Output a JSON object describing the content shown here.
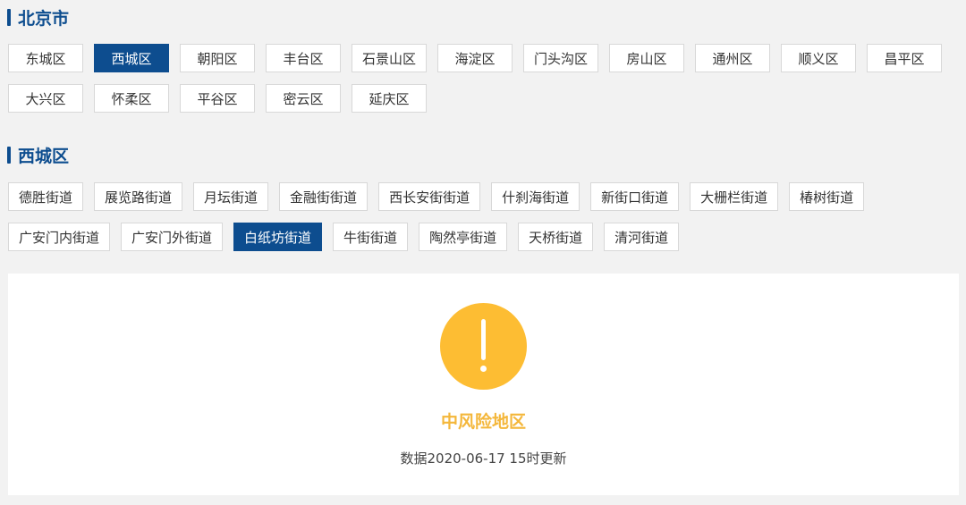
{
  "city": {
    "title": "北京市",
    "districts": [
      {
        "label": "东城区",
        "active": false
      },
      {
        "label": "西城区",
        "active": true
      },
      {
        "label": "朝阳区",
        "active": false
      },
      {
        "label": "丰台区",
        "active": false
      },
      {
        "label": "石景山区",
        "active": false
      },
      {
        "label": "海淀区",
        "active": false
      },
      {
        "label": "门头沟区",
        "active": false
      },
      {
        "label": "房山区",
        "active": false
      },
      {
        "label": "通州区",
        "active": false
      },
      {
        "label": "顺义区",
        "active": false
      },
      {
        "label": "昌平区",
        "active": false
      },
      {
        "label": "大兴区",
        "active": false
      },
      {
        "label": "怀柔区",
        "active": false
      },
      {
        "label": "平谷区",
        "active": false
      },
      {
        "label": "密云区",
        "active": false
      },
      {
        "label": "延庆区",
        "active": false
      }
    ]
  },
  "district": {
    "title": "西城区",
    "streets": [
      {
        "label": "德胜街道",
        "active": false
      },
      {
        "label": "展览路街道",
        "active": false
      },
      {
        "label": "月坛街道",
        "active": false
      },
      {
        "label": "金融街街道",
        "active": false
      },
      {
        "label": "西长安街街道",
        "active": false
      },
      {
        "label": "什刹海街道",
        "active": false
      },
      {
        "label": "新街口街道",
        "active": false
      },
      {
        "label": "大栅栏街道",
        "active": false
      },
      {
        "label": "椿树街道",
        "active": false
      },
      {
        "label": "广安门内街道",
        "active": false
      },
      {
        "label": "广安门外街道",
        "active": false
      },
      {
        "label": "白纸坊街道",
        "active": true
      },
      {
        "label": "牛街街道",
        "active": false
      },
      {
        "label": "陶然亭街道",
        "active": false
      },
      {
        "label": "天桥街道",
        "active": false
      },
      {
        "label": "清河街道",
        "active": false
      }
    ]
  },
  "result": {
    "icon": "warning-exclamation-icon",
    "risk_level": "中风险地区",
    "update_text": "数据2020-06-17 15时更新",
    "colors": {
      "icon": "#fdbd33",
      "risk_text": "#f4b73b",
      "active_button": "#0d4d8f"
    }
  }
}
